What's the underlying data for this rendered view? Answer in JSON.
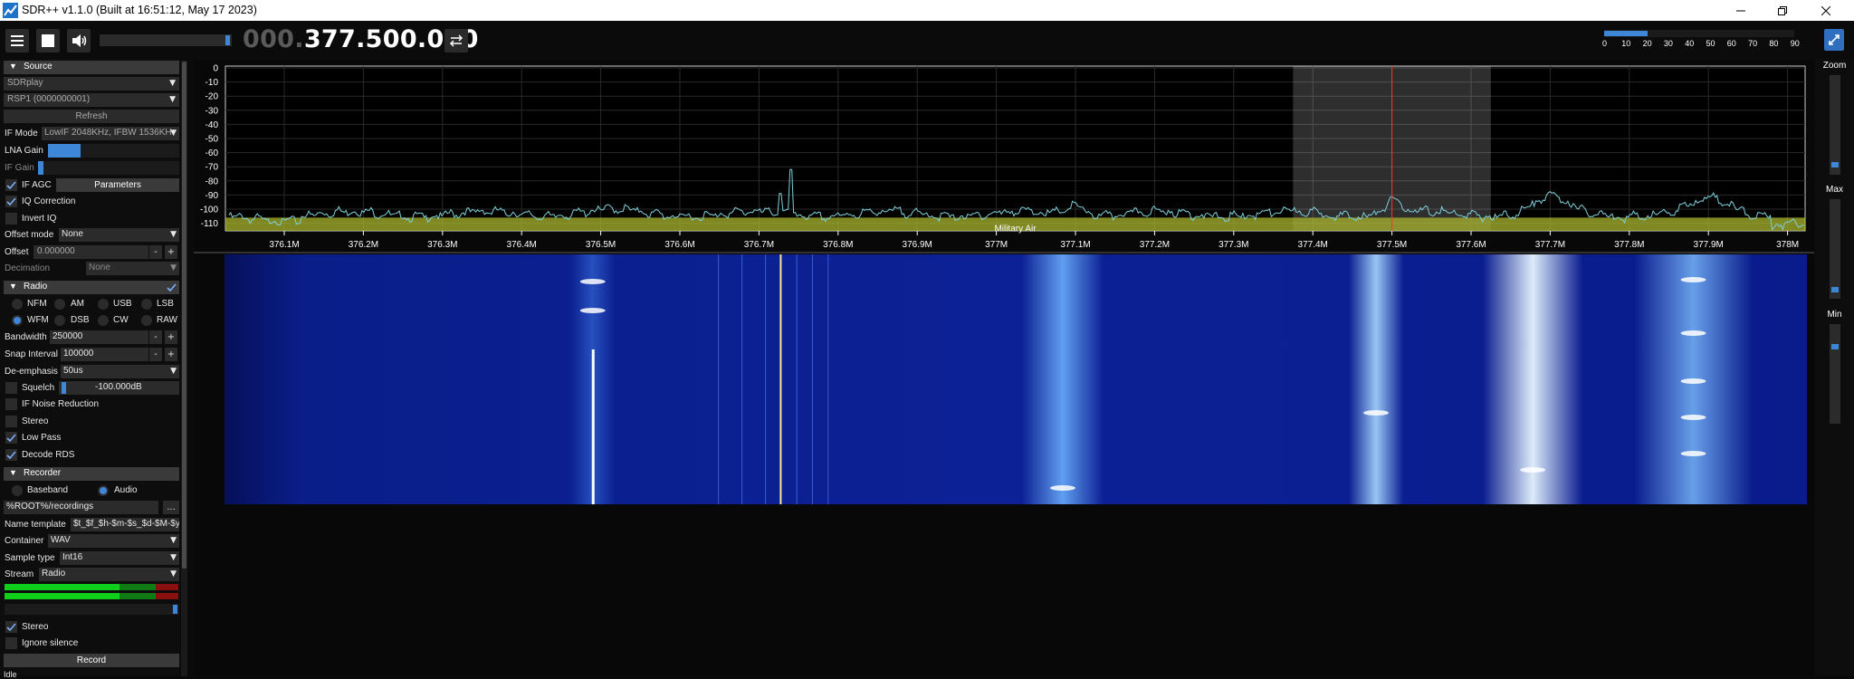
{
  "window": {
    "title": "SDR++ v1.1.0 (Built at 16:51:12, May 17 2023)",
    "controls": [
      "minimize-icon",
      "restore-icon",
      "close-icon"
    ]
  },
  "toolbar": {
    "frequency_dim": "000.",
    "frequency_main": "377.500.000",
    "snr_ticks": [
      "0",
      "10",
      "20",
      "30",
      "40",
      "50",
      "60",
      "70",
      "80",
      "90"
    ],
    "volume_level": 1.0,
    "snr_level": 0.22
  },
  "source": {
    "header": "Source",
    "device": "SDRplay",
    "serial": "RSP1 (0000000001)",
    "refresh_label": "Refresh",
    "if_mode_label": "IF Mode",
    "if_mode_value": "LowIF 2048KHz, IFBW 1536KH",
    "lna_gain_label": "LNA Gain",
    "lna_gain_level": 0.25,
    "if_gain_label": "IF Gain",
    "if_gain_level": 0.04,
    "if_agc_label": "IF AGC",
    "parameters_label": "Parameters",
    "iq_correction_label": "IQ Correction",
    "invert_iq_label": "Invert IQ",
    "offset_mode_label": "Offset mode",
    "offset_mode_value": "None",
    "offset_label": "Offset",
    "offset_value": "0.000000",
    "decimation_label": "Decimation",
    "decimation_value": "None"
  },
  "radio": {
    "header": "Radio",
    "modes_row1": [
      "NFM",
      "AM",
      "USB",
      "LSB"
    ],
    "modes_row2": [
      "WFM",
      "DSB",
      "CW",
      "RAW"
    ],
    "bandwidth_label": "Bandwidth",
    "bandwidth_value": "250000",
    "snap_label": "Snap Interval",
    "snap_value": "100000",
    "deemph_label": "De-emphasis",
    "deemph_value": "50us",
    "squelch_label": "Squelch",
    "squelch_value": "-100.000dB",
    "if_nr_label": "IF Noise Reduction",
    "stereo_label": "Stereo",
    "low_pass_label": "Low Pass",
    "decode_rds_label": "Decode RDS"
  },
  "recorder": {
    "header": "Recorder",
    "baseband_label": "Baseband",
    "audio_label": "Audio",
    "path_value": "%ROOT%/recordings",
    "browse_label": "...",
    "name_template_label": "Name template",
    "name_template_value": "$t_$f_$h-$m-$s_$d-$M-$y",
    "container_label": "Container",
    "container_value": "WAV",
    "sample_type_label": "Sample type",
    "sample_type_value": "Int16",
    "stream_label": "Stream",
    "stream_value": "Radio",
    "stereo_label": "Stereo",
    "ignore_silence_label": "Ignore silence",
    "record_label": "Record",
    "status_value": "Idle"
  },
  "fft": {
    "y_ticks": [
      "0",
      "-10",
      "-20",
      "-30",
      "-40",
      "-50",
      "-60",
      "-70",
      "-80",
      "-90",
      "-100",
      "-110"
    ],
    "x_ticks": [
      "376.1M",
      "376.2M",
      "376.3M",
      "376.4M",
      "376.5M",
      "376.6M",
      "376.7M",
      "376.8M",
      "376.9M",
      "377M",
      "377.1M",
      "377.2M",
      "377.3M",
      "377.4M",
      "377.5M",
      "377.6M",
      "377.7M",
      "377.8M",
      "377.9M",
      "378M"
    ],
    "band_label": "Military Air"
  },
  "right_panel": {
    "zoom_label": "Zoom",
    "max_label": "Max",
    "min_label": "Min"
  },
  "colors": {
    "accent": "#3d86d8",
    "band_plan": "#a9b52f",
    "spectrum_line": "#7fd0dc",
    "vfo_line": "#ff3030"
  }
}
